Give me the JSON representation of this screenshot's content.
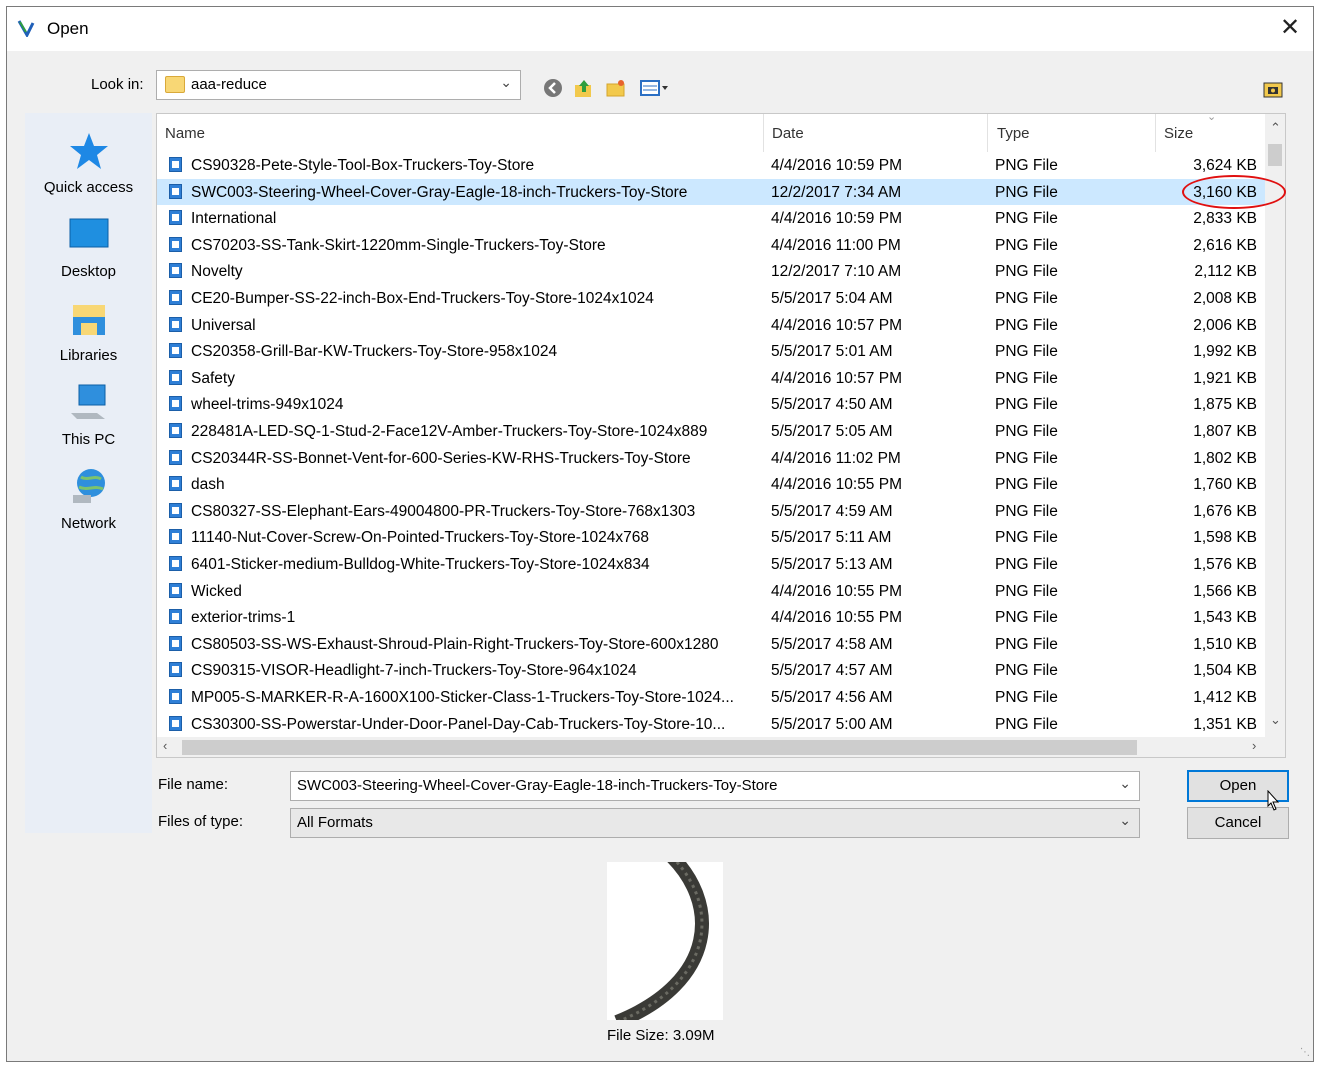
{
  "window": {
    "title": "Open",
    "close_glyph": "✕"
  },
  "lookin": {
    "label": "Look in:",
    "value": "aaa-reduce"
  },
  "toolbar": {
    "icons": [
      "back-icon",
      "up-folder-icon",
      "new-folder-icon",
      "view-menu-icon"
    ]
  },
  "places": [
    {
      "label": "Quick access",
      "icon": "quick-access-icon"
    },
    {
      "label": "Desktop",
      "icon": "desktop-icon"
    },
    {
      "label": "Libraries",
      "icon": "libraries-icon"
    },
    {
      "label": "This PC",
      "icon": "this-pc-icon"
    },
    {
      "label": "Network",
      "icon": "network-icon"
    }
  ],
  "columns": {
    "name": "Name",
    "date": "Date",
    "type": "Type",
    "size": "Size"
  },
  "files": [
    {
      "name": "CS90328-Pete-Style-Tool-Box-Truckers-Toy-Store",
      "date": "4/4/2016 10:59 PM",
      "type": "PNG File",
      "size": "3,624 KB"
    },
    {
      "name": "SWC003-Steering-Wheel-Cover-Gray-Eagle-18-inch-Truckers-Toy-Store",
      "date": "12/2/2017 7:34 AM",
      "type": "PNG File",
      "size": "3,160 KB",
      "selected": true
    },
    {
      "name": "International",
      "date": "4/4/2016 10:59 PM",
      "type": "PNG File",
      "size": "2,833 KB"
    },
    {
      "name": "CS70203-SS-Tank-Skirt-1220mm-Single-Truckers-Toy-Store",
      "date": "4/4/2016 11:00 PM",
      "type": "PNG File",
      "size": "2,616 KB"
    },
    {
      "name": "Novelty",
      "date": "12/2/2017 7:10 AM",
      "type": "PNG File",
      "size": "2,112 KB"
    },
    {
      "name": "CE20-Bumper-SS-22-inch-Box-End-Truckers-Toy-Store-1024x1024",
      "date": "5/5/2017 5:04 AM",
      "type": "PNG File",
      "size": "2,008 KB"
    },
    {
      "name": "Universal",
      "date": "4/4/2016 10:57 PM",
      "type": "PNG File",
      "size": "2,006 KB"
    },
    {
      "name": "CS20358-Grill-Bar-KW-Truckers-Toy-Store-958x1024",
      "date": "5/5/2017 5:01 AM",
      "type": "PNG File",
      "size": "1,992 KB"
    },
    {
      "name": "Safety",
      "date": "4/4/2016 10:57 PM",
      "type": "PNG File",
      "size": "1,921 KB"
    },
    {
      "name": "wheel-trims-949x1024",
      "date": "5/5/2017 4:50 AM",
      "type": "PNG File",
      "size": "1,875 KB"
    },
    {
      "name": "228481A-LED-SQ-1-Stud-2-Face12V-Amber-Truckers-Toy-Store-1024x889",
      "date": "5/5/2017 5:05 AM",
      "type": "PNG File",
      "size": "1,807 KB"
    },
    {
      "name": "CS20344R-SS-Bonnet-Vent-for-600-Series-KW-RHS-Truckers-Toy-Store",
      "date": "4/4/2016 11:02 PM",
      "type": "PNG File",
      "size": "1,802 KB"
    },
    {
      "name": "dash",
      "date": "4/4/2016 10:55 PM",
      "type": "PNG File",
      "size": "1,760 KB"
    },
    {
      "name": "CS80327-SS-Elephant-Ears-49004800-PR-Truckers-Toy-Store-768x1303",
      "date": "5/5/2017 4:59 AM",
      "type": "PNG File",
      "size": "1,676 KB"
    },
    {
      "name": "11140-Nut-Cover-Screw-On-Pointed-Truckers-Toy-Store-1024x768",
      "date": "5/5/2017 5:11 AM",
      "type": "PNG File",
      "size": "1,598 KB"
    },
    {
      "name": "6401-Sticker-medium-Bulldog-White-Truckers-Toy-Store-1024x834",
      "date": "5/5/2017 5:13 AM",
      "type": "PNG File",
      "size": "1,576 KB"
    },
    {
      "name": "Wicked",
      "date": "4/4/2016 10:55 PM",
      "type": "PNG File",
      "size": "1,566 KB"
    },
    {
      "name": "exterior-trims-1",
      "date": "4/4/2016 10:55 PM",
      "type": "PNG File",
      "size": "1,543 KB"
    },
    {
      "name": "CS80503-SS-WS-Exhaust-Shroud-Plain-Right-Truckers-Toy-Store-600x1280",
      "date": "5/5/2017 4:58 AM",
      "type": "PNG File",
      "size": "1,510 KB"
    },
    {
      "name": "CS90315-VISOR-Headlight-7-inch-Truckers-Toy-Store-964x1024",
      "date": "5/5/2017 4:57 AM",
      "type": "PNG File",
      "size": "1,504 KB"
    },
    {
      "name": "MP005-S-MARKER-R-A-1600X100-Sticker-Class-1-Truckers-Toy-Store-1024...",
      "date": "5/5/2017 4:56 AM",
      "type": "PNG File",
      "size": "1,412 KB"
    },
    {
      "name": "CS30300-SS-Powerstar-Under-Door-Panel-Day-Cab-Truckers-Toy-Store-10...",
      "date": "5/5/2017 5:00 AM",
      "type": "PNG File",
      "size": "1,351 KB"
    }
  ],
  "filename": {
    "label": "File name:",
    "value": "SWC003-Steering-Wheel-Cover-Gray-Eagle-18-inch-Truckers-Toy-Store"
  },
  "filetype": {
    "label": "Files of type:",
    "value": "All Formats"
  },
  "buttons": {
    "open": "Open",
    "cancel": "Cancel"
  },
  "preview": {
    "file_size": "File Size: 3.09M"
  },
  "colors": {
    "selection": "#cce8ff",
    "accent": "#0078d7",
    "highlight_ring": "#e01010"
  }
}
